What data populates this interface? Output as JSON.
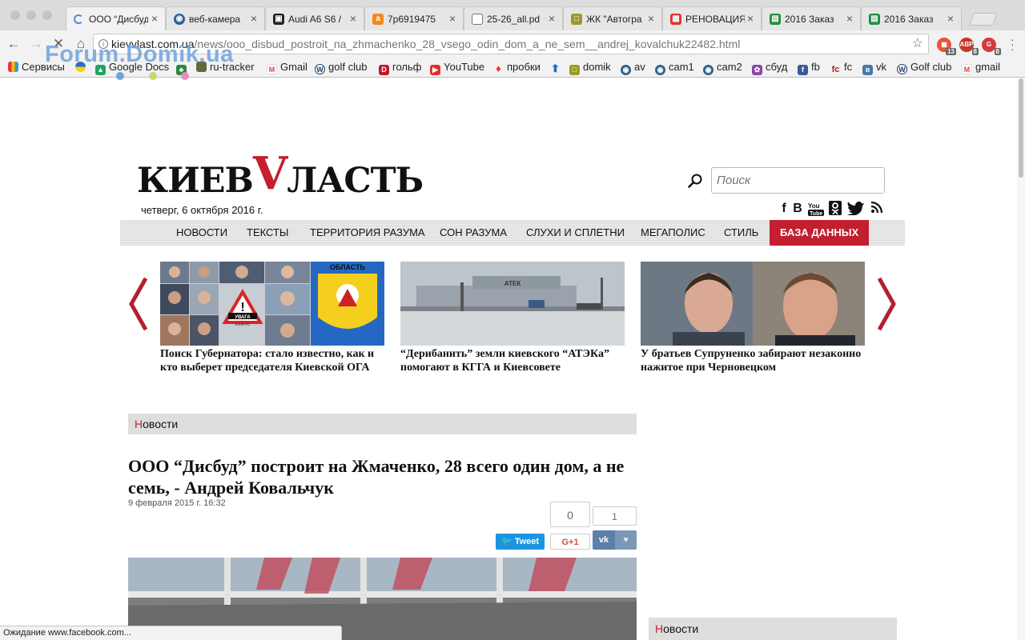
{
  "browser": {
    "tabs": [
      {
        "title": "ООО “Дисбуд” построит",
        "icon": "loading-spinner-icon",
        "active": true
      },
      {
        "title": "веб-камера",
        "icon": "camera-site-icon"
      },
      {
        "title": "Audi A6 S6 /",
        "icon": "audi-site-icon"
      },
      {
        "title": "7p6919475",
        "icon": "amazon-icon"
      },
      {
        "title": "25-26_all.pd",
        "icon": "document-icon"
      },
      {
        "title": "ЖК \"Автогра",
        "icon": "chat-icon"
      },
      {
        "title": "РЕНОВАЦИЯ",
        "icon": "grid-site-icon"
      },
      {
        "title": "2016 Заказ",
        "icon": "sheets-icon"
      },
      {
        "title": "2016 Заказ",
        "icon": "sheets-icon"
      }
    ],
    "url_host": "kievvlast.com.ua",
    "url_path": "/news/ooo_disbud_postroit_na_zhmachenko_28_vsego_odin_dom_a_ne_sem__andrej_kovalchuk22482.html",
    "extension_badges": [
      "13",
      "8",
      "8"
    ],
    "extension_icons": [
      "ext-calendar-icon",
      "ext-abp-icon",
      "ext-ghost-icon"
    ],
    "bookmarks": [
      {
        "label": "Сервисы",
        "icon": "apps-grid-icon"
      },
      {
        "label": "",
        "icon": "ukraine-flag-icon"
      },
      {
        "label": "Google Docs",
        "icon": "google-drive-icon"
      },
      {
        "label": "",
        "icon": "tree-icon"
      },
      {
        "label": "ru-tracker",
        "icon": "tracker-icon"
      },
      {
        "label": "Gmail",
        "icon": "gmail-icon"
      },
      {
        "label": "golf club",
        "icon": "vw-icon"
      },
      {
        "label": "гольф",
        "icon": "d-logo-icon"
      },
      {
        "label": "YouTube",
        "icon": "youtube-icon"
      },
      {
        "label": "пробки",
        "icon": "map-pin-icon"
      },
      {
        "label": "",
        "icon": "arrow-up-icon"
      },
      {
        "label": "domik",
        "icon": "domik-icon"
      },
      {
        "label": "av",
        "icon": "globe-icon"
      },
      {
        "label": "cam1",
        "icon": "globe-icon"
      },
      {
        "label": "cam2",
        "icon": "globe-icon"
      },
      {
        "label": "сбуд",
        "icon": "sbud-icon"
      },
      {
        "label": "fb",
        "icon": "facebook-icon"
      },
      {
        "label": "fc",
        "icon": "fc-icon"
      },
      {
        "label": "vk",
        "icon": "vk-icon"
      },
      {
        "label": "Golf club",
        "icon": "vw-icon"
      },
      {
        "label": "gmail",
        "icon": "gmail-icon"
      }
    ],
    "watermark": "Forum.Domik.ua",
    "status_text": "Ожидание www.facebook.com..."
  },
  "site": {
    "logo_text_left": "КИЕВ",
    "logo_text_v": "V",
    "logo_text_right": "ЛАСТЬ",
    "date": "четверг, 6 октября 2016 г.",
    "search_placeholder": "Поиск",
    "socials": [
      "facebook-icon",
      "vk-icon",
      "youtube-icon",
      "odnoklassniki-icon",
      "twitter-icon",
      "rss-icon"
    ],
    "nav": [
      {
        "label": "НОВОСТИ"
      },
      {
        "label": "ТЕКСТЫ"
      },
      {
        "label": "ТЕРРИТОРИЯ РАЗУМА"
      },
      {
        "label": "СОН РАЗУМА"
      },
      {
        "label": "СЛУХИ И СПЛЕТНИ"
      },
      {
        "label": "МЕГАПОЛИС"
      },
      {
        "label": "СТИЛЬ"
      },
      {
        "label": "БАЗА ДАННЫХ",
        "highlight": true
      }
    ]
  },
  "slider": [
    {
      "caption": "Поиск Губернатора: стало известно, как и кто выберет председателя Киевской ОГА",
      "sign_text": "УВАГА",
      "sign_subtext": "КОНКУРС",
      "banner_text": "ОБЛАСТЬ"
    },
    {
      "caption": "“Дерибанить” земли киевского “АТЭКа” помогают в КГГА и Киевсовете",
      "building_text": "АТЕК"
    },
    {
      "caption": "У братьев Супруненко забирают незаконно нажитое при Черновецком"
    }
  ],
  "article": {
    "section": "Новости",
    "title": "ООО “Дисбуд” построит на Жмаченко, 28 всего один дом, а не семь, - Андрей Ковальчук",
    "date": "9 февраля 2015 г. 16:32",
    "counter_top": "0",
    "counter_right": "1",
    "tweet_label": "Tweet",
    "gplus_label": "G+1"
  },
  "sidebar": {
    "section": "Новости"
  }
}
